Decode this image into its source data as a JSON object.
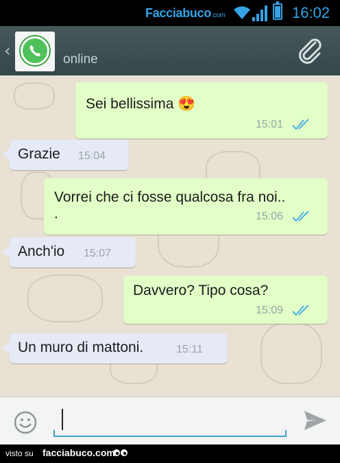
{
  "status_bar": {
    "brand": "Facciabuco",
    "brand_suffix": ".com",
    "time": "16:02",
    "accent_color": "#35a3e6"
  },
  "header": {
    "status": "online",
    "avatar_icon": "whatsapp-logo-icon",
    "back_icon": "chevron-left-icon",
    "attach_icon": "paperclip-icon"
  },
  "messages": [
    {
      "direction": "outgoing",
      "text": "Sei bellissima 😍",
      "time": "15:01",
      "read": true
    },
    {
      "direction": "incoming",
      "text": "Grazie",
      "time": "15:04"
    },
    {
      "direction": "outgoing",
      "text": "Vorrei che ci fosse qualcosa fra noi..",
      "text_line2": ".",
      "time": "15:06",
      "read": true
    },
    {
      "direction": "incoming",
      "text": "Anch'io",
      "time": "15:07"
    },
    {
      "direction": "outgoing",
      "text": "Davvero? Tipo cosa?",
      "time": "15:09",
      "read": true
    },
    {
      "direction": "incoming",
      "text": "Un muro di mattoni.",
      "time": "15:11"
    }
  ],
  "input_bar": {
    "value": "",
    "emoji_icon": "smiley-icon",
    "send_icon": "send-icon"
  },
  "footer": {
    "visto_label": "visto su",
    "site": "facciabuco.com"
  },
  "colors": {
    "outgoing_bubble": "#e2ffc8",
    "incoming_bubble": "#e6eaf6",
    "read_ticks": "#4fb0e6",
    "header_bg": "#3a4a4c",
    "chat_bg": "#e9e1d3"
  }
}
